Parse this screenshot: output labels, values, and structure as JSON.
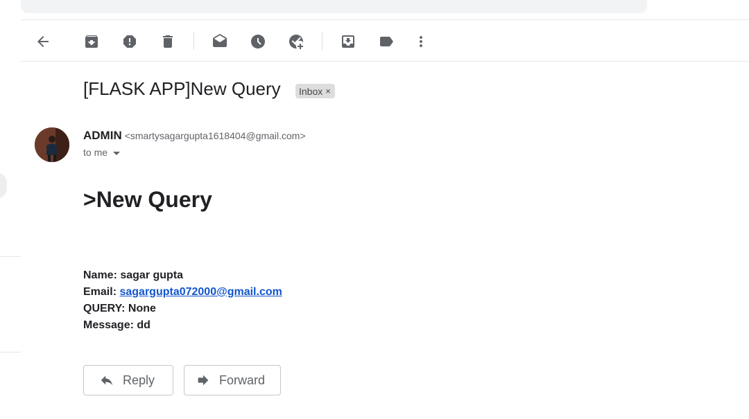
{
  "toolbar": {
    "items": [
      {
        "name": "back",
        "icon": "arrow-left-icon"
      },
      {
        "name": "archive",
        "icon": "archive-icon"
      },
      {
        "name": "report-spam",
        "icon": "report-icon"
      },
      {
        "name": "delete",
        "icon": "trash-icon"
      },
      {
        "name": "mark-unread",
        "icon": "envelope-open-icon"
      },
      {
        "name": "snooze",
        "icon": "clock-icon"
      },
      {
        "name": "add-to-tasks",
        "icon": "task-add-icon"
      },
      {
        "name": "move-to",
        "icon": "move-to-inbox-icon"
      },
      {
        "name": "labels",
        "icon": "label-icon"
      },
      {
        "name": "more",
        "icon": "more-vert-icon"
      }
    ]
  },
  "email": {
    "subject": "[FLASK APP]New Query",
    "label": "Inbox",
    "label_remove": "×",
    "sender_name": "ADMIN",
    "sender_email": "<smartysagargupta1618404@gmail.com>",
    "to": "to me",
    "heading": ">New Query",
    "fields": {
      "name_label": "Name:",
      "name_value": "sagar gupta",
      "email_label": "Email:",
      "email_value": "sagargupta072000@gmail.com",
      "query_label": "QUERY:",
      "query_value": "None",
      "message_label": "Message:",
      "message_value": "dd"
    }
  },
  "actions": {
    "reply": "Reply",
    "forward": "Forward"
  },
  "colors": {
    "link": "#1155cc",
    "icon": "#5f6368",
    "chip_bg": "#dddddd"
  }
}
